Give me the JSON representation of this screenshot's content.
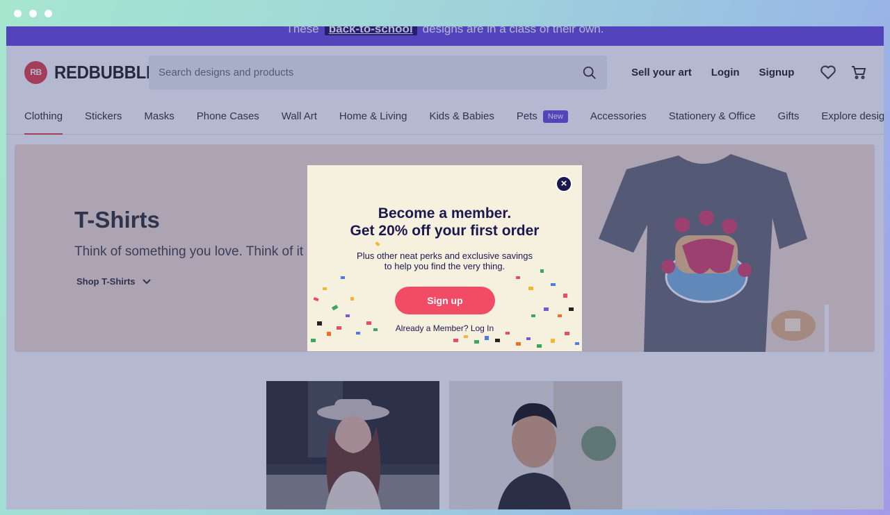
{
  "promo": {
    "prefix": "These",
    "link": "back-to-school",
    "suffix": "designs are in a class of their own."
  },
  "header": {
    "logo_mark": "RB",
    "logo_text": "REDBUBBLE",
    "search_placeholder": "Search designs and products",
    "sell_label": "Sell your art",
    "login_label": "Login",
    "signup_label": "Signup"
  },
  "categories": [
    {
      "label": "Clothing",
      "active": true
    },
    {
      "label": "Stickers"
    },
    {
      "label": "Masks"
    },
    {
      "label": "Phone Cases"
    },
    {
      "label": "Wall Art"
    },
    {
      "label": "Home & Living"
    },
    {
      "label": "Kids & Babies"
    },
    {
      "label": "Pets",
      "badge": "New"
    },
    {
      "label": "Accessories"
    },
    {
      "label": "Stationery & Office"
    },
    {
      "label": "Gifts"
    },
    {
      "label": "Explore designs"
    }
  ],
  "hero": {
    "title": "T-Shirts",
    "subtitle": "Think of something you love. Think of it on a",
    "link": "Shop T-Shirts"
  },
  "modal": {
    "title_line1": "Become a member.",
    "title_line2": "Get 20% off your first order",
    "body_line1": "Plus other neat perks and exclusive savings",
    "body_line2": "to help you find the very thing.",
    "button": "Sign up",
    "login_text": "Already a Member? Log In"
  },
  "colors": {
    "brand": "#e4424b",
    "promo": "#6a4ee0",
    "cta": "#f24b65",
    "modal_bg": "#f6f0de",
    "navy": "#1b1850"
  }
}
